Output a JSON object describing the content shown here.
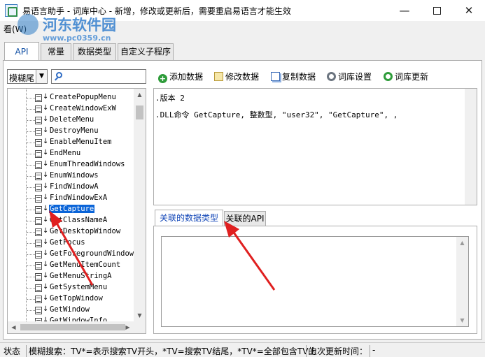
{
  "window": {
    "title": "易语言助手 - 词库中心 - 新增，修改或更新后，需要重启易语言才能生效",
    "min_glyph": "—",
    "close_glyph": "✕"
  },
  "menu": {
    "item": "看(W)"
  },
  "watermark": {
    "title": "河东软件园",
    "url": "www.pc0359.cn"
  },
  "tabs": [
    {
      "label": "API",
      "active": true
    },
    {
      "label": "常量"
    },
    {
      "label": "数据类型"
    },
    {
      "label": "自定义子程序"
    }
  ],
  "search": {
    "mode_value": "模糊尾",
    "dropdown_glyph": "▼",
    "query": ""
  },
  "toolbar": {
    "add": "添加数据",
    "edit": "修改数据",
    "copy": "复制数据",
    "settings": "词库设置",
    "update": "词库更新",
    "add_glyph": "+"
  },
  "tree": {
    "arrow_glyph": "↓",
    "items": [
      "CreatePopupMenu",
      "CreateWindowExW",
      "DeleteMenu",
      "DestroyMenu",
      "EnableMenuItem",
      "EndMenu",
      "EnumThreadWindows",
      "EnumWindows",
      "FindWindowA",
      "FindWindowExA",
      "GetCapture",
      "GetClassNameA",
      "GetDesktopWindow",
      "GetFocus",
      "GetForegroundWindow",
      "GetMenuItemCount",
      "GetMenuStringA",
      "GetSystemMenu",
      "GetTopWindow",
      "GetWindow",
      "GetWindowInfo"
    ],
    "selected": "GetCapture",
    "scroll_up": "▲",
    "scroll_down": "▼",
    "scroll_left": "◀",
    "scroll_right": "▶"
  },
  "code": {
    "line1": ".版本 2",
    "line2": ".DLL命令 GetCapture, 整数型, \"user32\", \"GetCapture\", ,"
  },
  "lower_tabs": [
    {
      "label": "关联的数据类型",
      "active": true
    },
    {
      "label": "关联的API"
    }
  ],
  "inner_list": {
    "scroll_up": "▲",
    "scroll_down": "▼"
  },
  "status": {
    "label": "状态",
    "hint": "模糊搜索：TV*=表示搜索TV开头，*TV=搜索TV结尾，*TV*=全部包含TV的",
    "last_update_label": "上次更新时间：",
    "last_update_value": "-"
  },
  "annotation": {
    "color": "#e02020"
  }
}
